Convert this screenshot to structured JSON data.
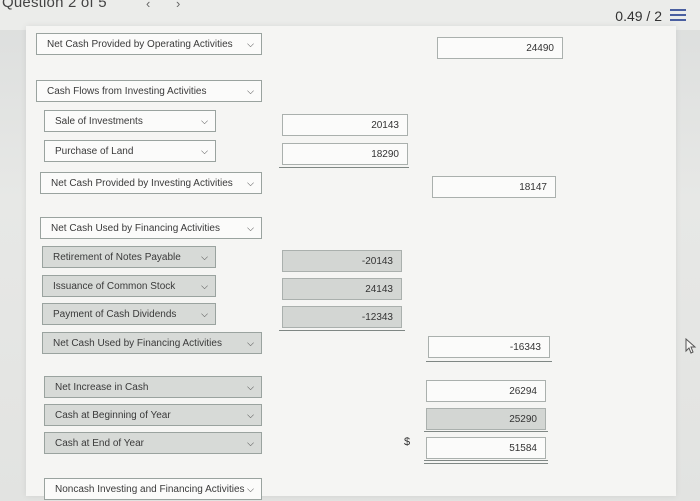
{
  "header": {
    "question_label": "Question 2 of 5",
    "prev_icon": "chevron-left-icon",
    "next_icon": "chevron-right-icon",
    "score": "0.49 / 2",
    "menu_icon": "list-menu-icon"
  },
  "operating": {
    "net_label": "Net Cash Provided by Operating Activities",
    "net_value": "24490"
  },
  "investing": {
    "heading": "Cash Flows from Investing Activities",
    "items": [
      {
        "label": "Sale of Investments",
        "value": "20143"
      },
      {
        "label": "Purchase of Land",
        "value": "18290"
      }
    ],
    "net_label": "Net Cash Provided by Investing Activities",
    "net_value": "18147"
  },
  "financing": {
    "heading": "Net Cash Used by Financing Activities",
    "items": [
      {
        "label": "Retirement of Notes Payable",
        "value": "-20143"
      },
      {
        "label": "Issuance of Common Stock",
        "value": "24143"
      },
      {
        "label": "Payment of Cash Dividends",
        "value": "-12343"
      }
    ],
    "net_label": "Net Cash Used by Financing Activities",
    "net_value": "-16343"
  },
  "summary": {
    "increase_label": "Net Increase in Cash",
    "increase_value": "26294",
    "beginning_label": "Cash at Beginning of Year",
    "beginning_value": "25290",
    "end_label": "Cash at End of Year",
    "currency": "$",
    "end_value": "51584",
    "noncash_label": "Noncash Investing and Financing Activities"
  }
}
